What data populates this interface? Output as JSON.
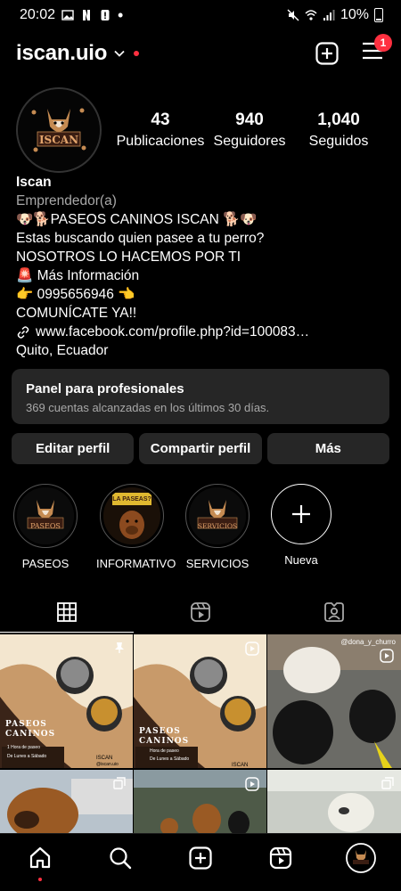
{
  "status_bar": {
    "time": "20:02",
    "battery": "10%"
  },
  "header": {
    "username": "iscan.uio",
    "notification_count": "1"
  },
  "profile": {
    "avatar_text": "ISCAN",
    "stats": [
      {
        "value": "43",
        "label": "Publicaciones"
      },
      {
        "value": "940",
        "label": "Seguidores"
      },
      {
        "value": "1,040",
        "label": "Seguidos"
      }
    ],
    "name": "Iscan",
    "category": "Emprendedor(a)",
    "bio_lines": [
      "🐶🐕PASEOS CANINOS ISCAN 🐕🐶",
      "Estas buscando quien pasee a tu perro?",
      "NOSOTROS LO HACEMOS POR TI",
      "🚨 Más Información",
      "👉 0995656946 👈",
      "COMUNÍCATE YA!!"
    ],
    "link": "www.facebook.com/profile.php?id=100083…",
    "location": "Quito, Ecuador"
  },
  "pro_panel": {
    "title": "Panel para profesionales",
    "subtitle": "369 cuentas alcanzadas en los últimos 30 días."
  },
  "buttons": {
    "edit": "Editar perfil",
    "share": "Compartir perfil",
    "more": "Más"
  },
  "highlights": [
    {
      "label": "PASEOS",
      "cover_text": "PASEOS"
    },
    {
      "label": "INFORMATIVO",
      "cover_text": "LA PASEAS?"
    },
    {
      "label": "SERVICIOS",
      "cover_text": "SERVICIOS"
    },
    {
      "label": "Nueva"
    }
  ],
  "posts": [
    {
      "caption_title": "PASEOS CANINOS",
      "caption_items": [
        "1 Hora de paseo",
        "De Lunes a Sábado"
      ],
      "brand": "ISCAN",
      "handle": "@iscan.uio"
    },
    {
      "caption_title": "PASEOS CANINOS",
      "caption_items": [
        "Hora de paseo",
        "De Lunes a Sábado"
      ],
      "brand": "ISCAN"
    },
    {
      "watermark": "@dona_y_churro"
    }
  ],
  "colors": {
    "accent_red": "#ff3040",
    "panel_bg": "#262626",
    "muted_text": "#a8a8a8"
  }
}
